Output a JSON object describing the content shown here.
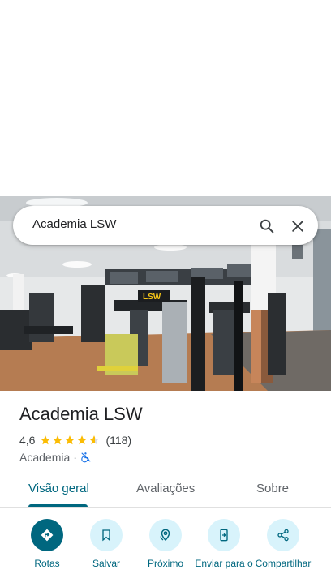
{
  "search": {
    "query": "Academia LSW"
  },
  "icons": {
    "search": "search-icon",
    "close": "close-icon",
    "wheelchair": "wheelchair-not-accessible-icon",
    "directions": "directions-icon",
    "save": "bookmark-icon",
    "nearby": "nearby-icon",
    "send": "send-to-phone-icon",
    "share": "share-icon"
  },
  "colors": {
    "accent": "#00677f",
    "star": "#fbbc04",
    "action_bg": "#d8f3fb",
    "wheelchair": "#1a73e8"
  },
  "place": {
    "name": "Academia LSW",
    "rating": "4,6",
    "rating_stars": 4.6,
    "review_count": "(118)",
    "category": "Academia",
    "separator": "·"
  },
  "tabs": [
    {
      "label": "Visão geral",
      "selected": true
    },
    {
      "label": "Avaliações",
      "selected": false
    },
    {
      "label": "Sobre",
      "selected": false
    }
  ],
  "actions": [
    {
      "label": "Rotas"
    },
    {
      "label": "Salvar"
    },
    {
      "label": "Próximo"
    },
    {
      "label": "Enviar para o"
    },
    {
      "label": "Compartilhar"
    }
  ]
}
